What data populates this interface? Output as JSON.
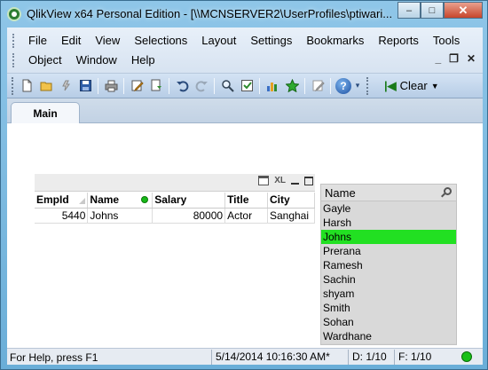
{
  "window": {
    "title": "QlikView x64 Personal Edition - [\\\\MCNSERVER2\\UserProfiles\\ptiwari...",
    "min_glyph": "–",
    "max_glyph": "□",
    "close_glyph": "✕"
  },
  "menu": {
    "row1": [
      "File",
      "Edit",
      "View",
      "Selections",
      "Layout",
      "Settings",
      "Bookmarks",
      "Reports",
      "Tools"
    ],
    "row2": [
      "Object",
      "Window",
      "Help"
    ],
    "mdi": [
      "_",
      "❐",
      "✕"
    ]
  },
  "toolbar": {
    "clear_label": "Clear",
    "icons": [
      "new-doc-icon",
      "open-icon",
      "reload-icon",
      "save-icon",
      "print-icon",
      "edit-script-icon",
      "reload-doc-icon",
      "undo-icon",
      "redo-icon",
      "search-icon",
      "current-selections-icon",
      "chart-icon",
      "bookmark-star-icon",
      "edit-icon",
      "help-icon"
    ]
  },
  "tabs": [
    {
      "label": "Main"
    }
  ],
  "table": {
    "xl_label": "XL",
    "columns": [
      "EmpId",
      "Name",
      "Salary",
      "Title",
      "City"
    ],
    "rows": [
      {
        "empid": "5440",
        "name": "Johns",
        "salary": "80000",
        "title": "Actor",
        "city": "Sanghai"
      }
    ]
  },
  "listbox": {
    "title": "Name",
    "items": [
      "Gayle",
      "Harsh",
      "Johns",
      "Prerana",
      "Ramesh",
      "Sachin",
      "shyam",
      "Smith",
      "Sohan",
      "Wardhane"
    ],
    "selected": "Johns",
    "selected_color": "#22e022"
  },
  "status": {
    "help_text": "For Help, press F1",
    "datetime": "5/14/2014 10:16:30 AM*",
    "distinct": "D: 1/10",
    "frequency": "F: 1/10"
  },
  "colors": {
    "selection_green": "#22e022",
    "window_chrome": "#6fb3d9"
  }
}
